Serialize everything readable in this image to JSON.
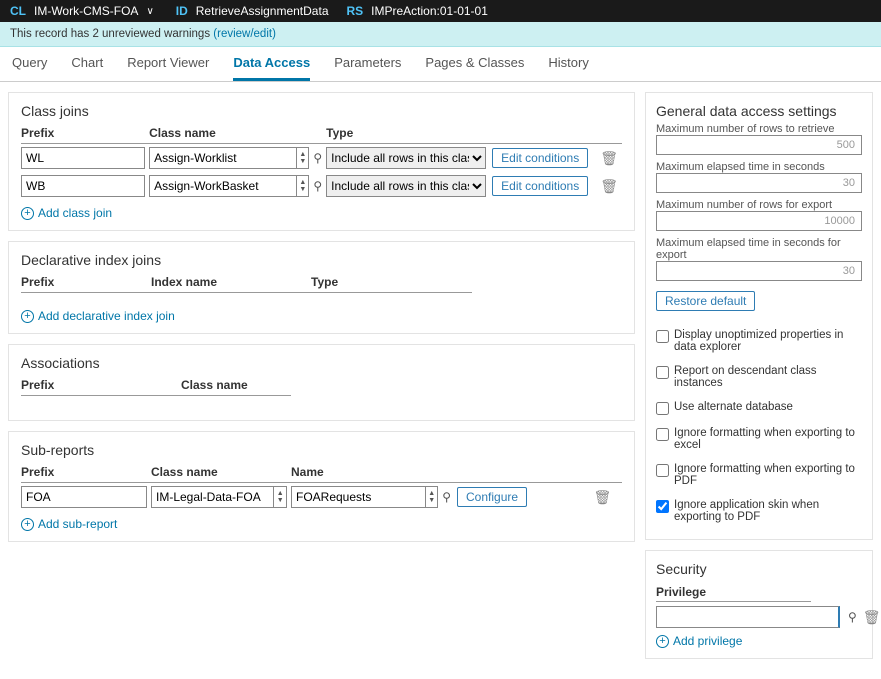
{
  "header": {
    "cl_label": "CL",
    "cl_value": "IM-Work-CMS-FOA",
    "id_label": "ID",
    "id_value": "RetrieveAssignmentData",
    "rs_label": "RS",
    "rs_value": "IMPreAction:01-01-01"
  },
  "warnbar": {
    "text": "This record has 2 unreviewed warnings ",
    "link": "(review/edit)"
  },
  "tabs": {
    "query": "Query",
    "chart": "Chart",
    "report_viewer": "Report Viewer",
    "data_access": "Data Access",
    "parameters": "Parameters",
    "pages_classes": "Pages & Classes",
    "history": "History"
  },
  "class_joins": {
    "title": "Class joins",
    "headers": {
      "prefix": "Prefix",
      "class": "Class name",
      "type": "Type"
    },
    "rows": [
      {
        "prefix": "WL",
        "class": "Assign-Worklist",
        "type": "Include all rows in this class",
        "edit": "Edit conditions"
      },
      {
        "prefix": "WB",
        "class": "Assign-WorkBasket",
        "type": "Include all rows in this class",
        "edit": "Edit conditions"
      }
    ],
    "add": "Add class join"
  },
  "declarative": {
    "title": "Declarative index joins",
    "headers": {
      "prefix": "Prefix",
      "index": "Index name",
      "type": "Type"
    },
    "add": "Add declarative index join"
  },
  "associations": {
    "title": "Associations",
    "headers": {
      "prefix": "Prefix",
      "class": "Class name"
    }
  },
  "subreports": {
    "title": "Sub-reports",
    "headers": {
      "prefix": "Prefix",
      "class": "Class name",
      "name": "Name"
    },
    "rows": [
      {
        "prefix": "FOA",
        "class": "IM-Legal-Data-FOA",
        "name": "FOARequests",
        "configure": "Configure"
      }
    ],
    "add": "Add sub-report"
  },
  "general": {
    "title": "General data access settings",
    "fields": {
      "max_rows": {
        "label": "Maximum number of rows to retrieve",
        "value": "500"
      },
      "max_time": {
        "label": "Maximum elapsed time in seconds",
        "value": "30"
      },
      "max_rows_export": {
        "label": "Maximum number of rows for export",
        "value": "10000"
      },
      "max_time_export": {
        "label": "Maximum elapsed time in seconds for export",
        "value": "30"
      }
    },
    "restore": "Restore default",
    "checks": {
      "unopt": "Display unoptimized properties in data explorer",
      "descendant": "Report on descendant class instances",
      "altdb": "Use alternate database",
      "excel": "Ignore formatting when exporting to excel",
      "pdf": "Ignore formatting when exporting to PDF",
      "skin": "Ignore application skin when exporting to PDF"
    }
  },
  "security": {
    "title": "Security",
    "privilege_label": "Privilege",
    "add": "Add privilege"
  }
}
